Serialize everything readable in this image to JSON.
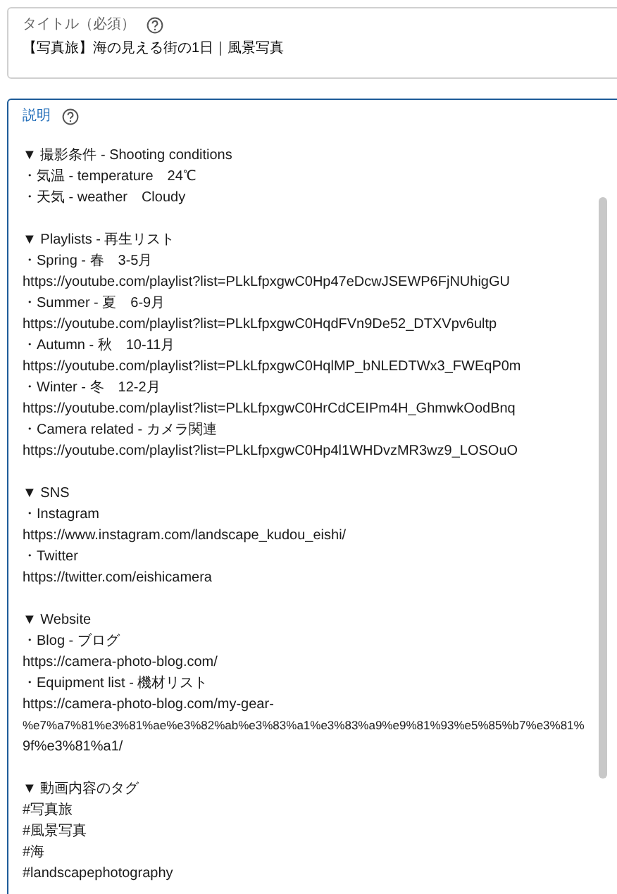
{
  "title_field": {
    "label": "タイトル（必須）",
    "value": "【写真旅】海の見える街の1日｜風景写真"
  },
  "description_field": {
    "label": "説明",
    "focused": true,
    "sections": [
      {
        "lines": [
          "▼ 撮影条件 - Shooting conditions",
          "・気温 - temperature　24℃",
          "・天気 - weather　Cloudy"
        ]
      },
      {
        "lines": [
          "▼ Playlists - 再生リスト",
          "・Spring - 春　3-5月",
          "https://youtube.com/playlist?list=PLkLfpxgwC0Hp47eDcwJSEWP6FjNUhigGU",
          "・Summer - 夏　6-9月",
          "https://youtube.com/playlist?list=PLkLfpxgwC0HqdFVn9De52_DTXVpv6ultp",
          "・Autumn - 秋　10-11月",
          "https://youtube.com/playlist?list=PLkLfpxgwC0HqlMP_bNLEDTWx3_FWEqP0m",
          "・Winter - 冬　12-2月",
          "https://youtube.com/playlist?list=PLkLfpxgwC0HrCdCEIPm4H_GhmwkOodBnq",
          "・Camera related - カメラ関連",
          "https://youtube.com/playlist?list=PLkLfpxgwC0Hp4l1WHDvzMR3wz9_LOSOuO"
        ]
      },
      {
        "lines": [
          "▼ SNS",
          "・Instagram",
          "https://www.instagram.com/landscape_kudou_eishi/",
          "・Twitter",
          "https://twitter.com/eishicamera"
        ]
      },
      {
        "lines": [
          "▼ Website",
          "・Blog - ブログ",
          "https://camera-photo-blog.com/",
          "・Equipment list - 機材リスト",
          "https://camera-photo-blog.com/my-gear-",
          "%e7%a7%81%e3%81%ae%e3%82%ab%e3%83%a1%e3%83%a9%e9%81%93%e5%85%b7%e3%81%",
          "9f%e3%81%a1/"
        ]
      },
      {
        "lines": [
          "▼ 動画内容のタグ",
          "#写真旅",
          "#風景写真",
          "#海",
          "#landscapephotography"
        ]
      }
    ]
  }
}
